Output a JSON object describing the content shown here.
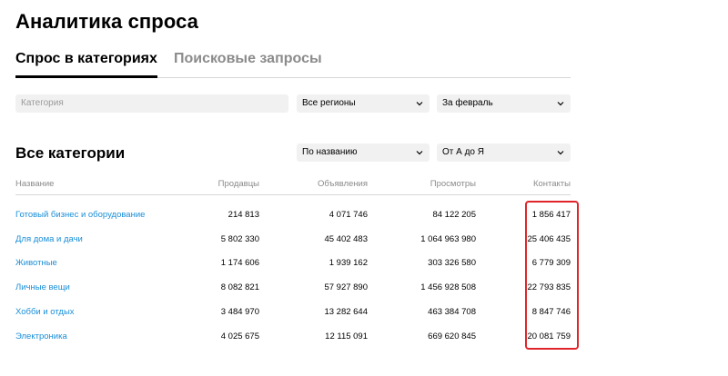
{
  "page": {
    "title": "Аналитика спроса"
  },
  "tabs": [
    {
      "label": "Спрос в категориях",
      "active": true
    },
    {
      "label": "Поисковые запросы",
      "active": false
    }
  ],
  "filters": {
    "category_placeholder": "Категория",
    "region": "Все регионы",
    "period": "За февраль"
  },
  "section": {
    "title": "Все категории",
    "sort_by": "По названию",
    "sort_order": "От А до Я"
  },
  "table": {
    "headers": [
      "Название",
      "Продавцы",
      "Объявления",
      "Просмотры",
      "Контакты"
    ],
    "rows": [
      [
        "Готовый бизнес и оборудование",
        "214 813",
        "4 071 746",
        "84 122 205",
        "1 856 417"
      ],
      [
        "Для дома и дачи",
        "5 802 330",
        "45 402 483",
        "1 064 963 980",
        "25 406 435"
      ],
      [
        "Животные",
        "1 174 606",
        "1 939 162",
        "303 326 580",
        "6 779 309"
      ],
      [
        "Личные вещи",
        "8 082 821",
        "57 927 890",
        "1 456 928 508",
        "22 793 835"
      ],
      [
        "Хобби и отдых",
        "3 484 970",
        "13 282 644",
        "463 384 708",
        "8 847 746"
      ],
      [
        "Электроника",
        "4 025 675",
        "12 115 091",
        "669 620 845",
        "20 081 759"
      ]
    ]
  },
  "colors": {
    "link": "#1a8fd8",
    "highlight": "#e0252a",
    "field_bg": "#f1f1f1"
  }
}
